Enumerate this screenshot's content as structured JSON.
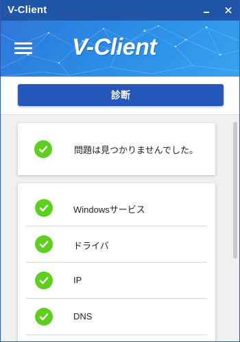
{
  "window": {
    "title": "V-Client",
    "minimize_label": "minimize",
    "close_label": "close"
  },
  "header": {
    "logo_text": "V-Client"
  },
  "diagnose": {
    "button_label": "診断"
  },
  "status": {
    "message": "問題は見つかりませんでした。",
    "icon": "check-circle-icon"
  },
  "checks": {
    "items": [
      {
        "label": "Windowsサービス",
        "icon": "check-circle-icon"
      },
      {
        "label": "ドライバ",
        "icon": "check-circle-icon"
      },
      {
        "label": "IP",
        "icon": "check-circle-icon"
      },
      {
        "label": "DNS",
        "icon": "check-circle-icon"
      }
    ]
  },
  "colors": {
    "titlebar": "#2155a8",
    "accent_button": "#2557b8",
    "check_green": "#5fcf1e"
  }
}
